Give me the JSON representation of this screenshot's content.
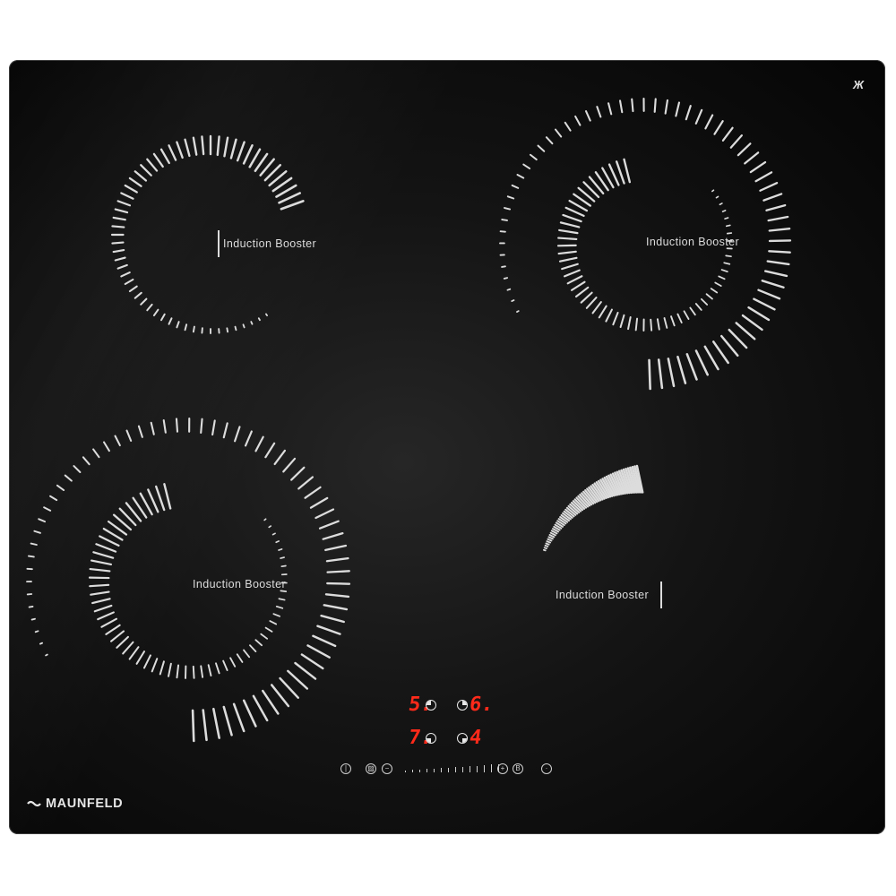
{
  "brand": {
    "name": "MAUNFELD"
  },
  "corner_logo": {
    "glyph": "Ж"
  },
  "zones": [
    {
      "id": "front-left",
      "label": "Induction Booster"
    },
    {
      "id": "back-left",
      "label": "Induction Booster"
    },
    {
      "id": "back-right",
      "label": "Induction Booster"
    },
    {
      "id": "front-right",
      "label": "Induction Booster"
    }
  ],
  "displays": [
    {
      "value": "5."
    },
    {
      "value": "6."
    },
    {
      "value": "7."
    },
    {
      "value": "4"
    }
  ],
  "controls": {
    "power_icon": "power-icon",
    "lock_icon": "lock-icon",
    "minus_icon": "minus-icon",
    "plus_icon": "plus-icon",
    "booster_label": "B",
    "timer_icon": "timer-icon"
  },
  "colors": {
    "panel": "#0a0a0a",
    "print": "#dcdcdc",
    "display": "#ff2a1a"
  }
}
